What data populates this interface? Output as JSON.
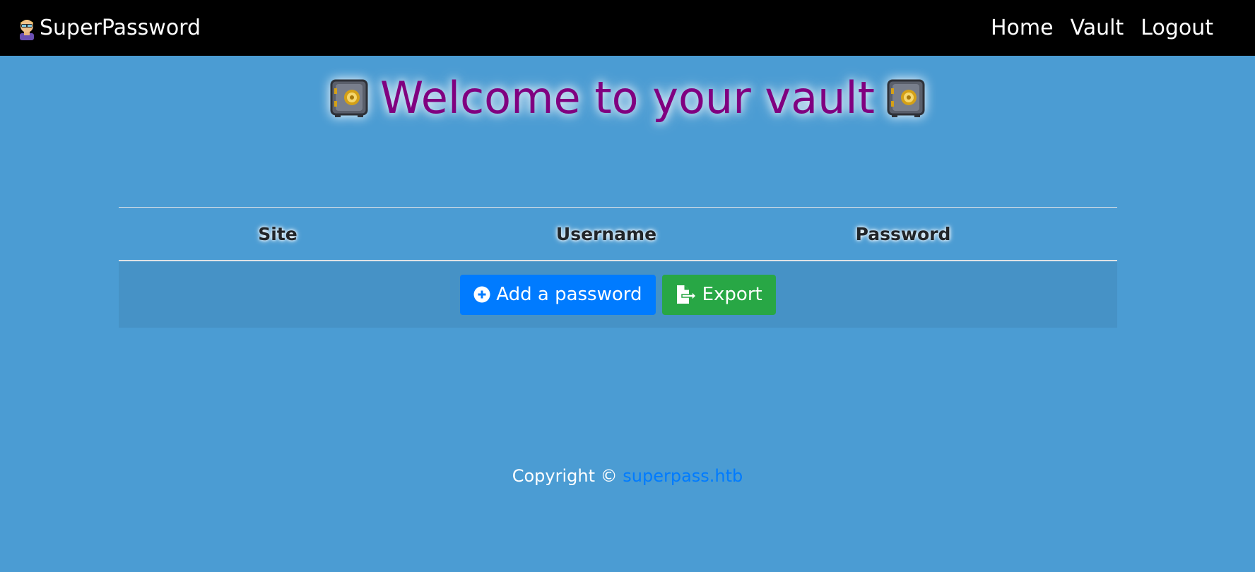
{
  "navbar": {
    "brand": "SuperPassword",
    "brand_icon": "hacker-icon",
    "links": [
      "Home",
      "Vault",
      "Logout"
    ]
  },
  "main": {
    "heading": "Welcome to your vault",
    "heading_icon": "safe-icon",
    "heading_color": "#800080"
  },
  "table": {
    "columns": [
      "Site",
      "Username",
      "Password"
    ],
    "add_button": "Add a password",
    "add_icon": "plus-circle-icon",
    "export_button": "Export",
    "export_icon": "file-export-icon"
  },
  "footer": {
    "copyright": "Copyright ©",
    "link": "superpass.htb"
  },
  "colors": {
    "background": "#4b9cd3",
    "navbar": "#000000",
    "primary": "#007bff",
    "success": "#28a745"
  }
}
